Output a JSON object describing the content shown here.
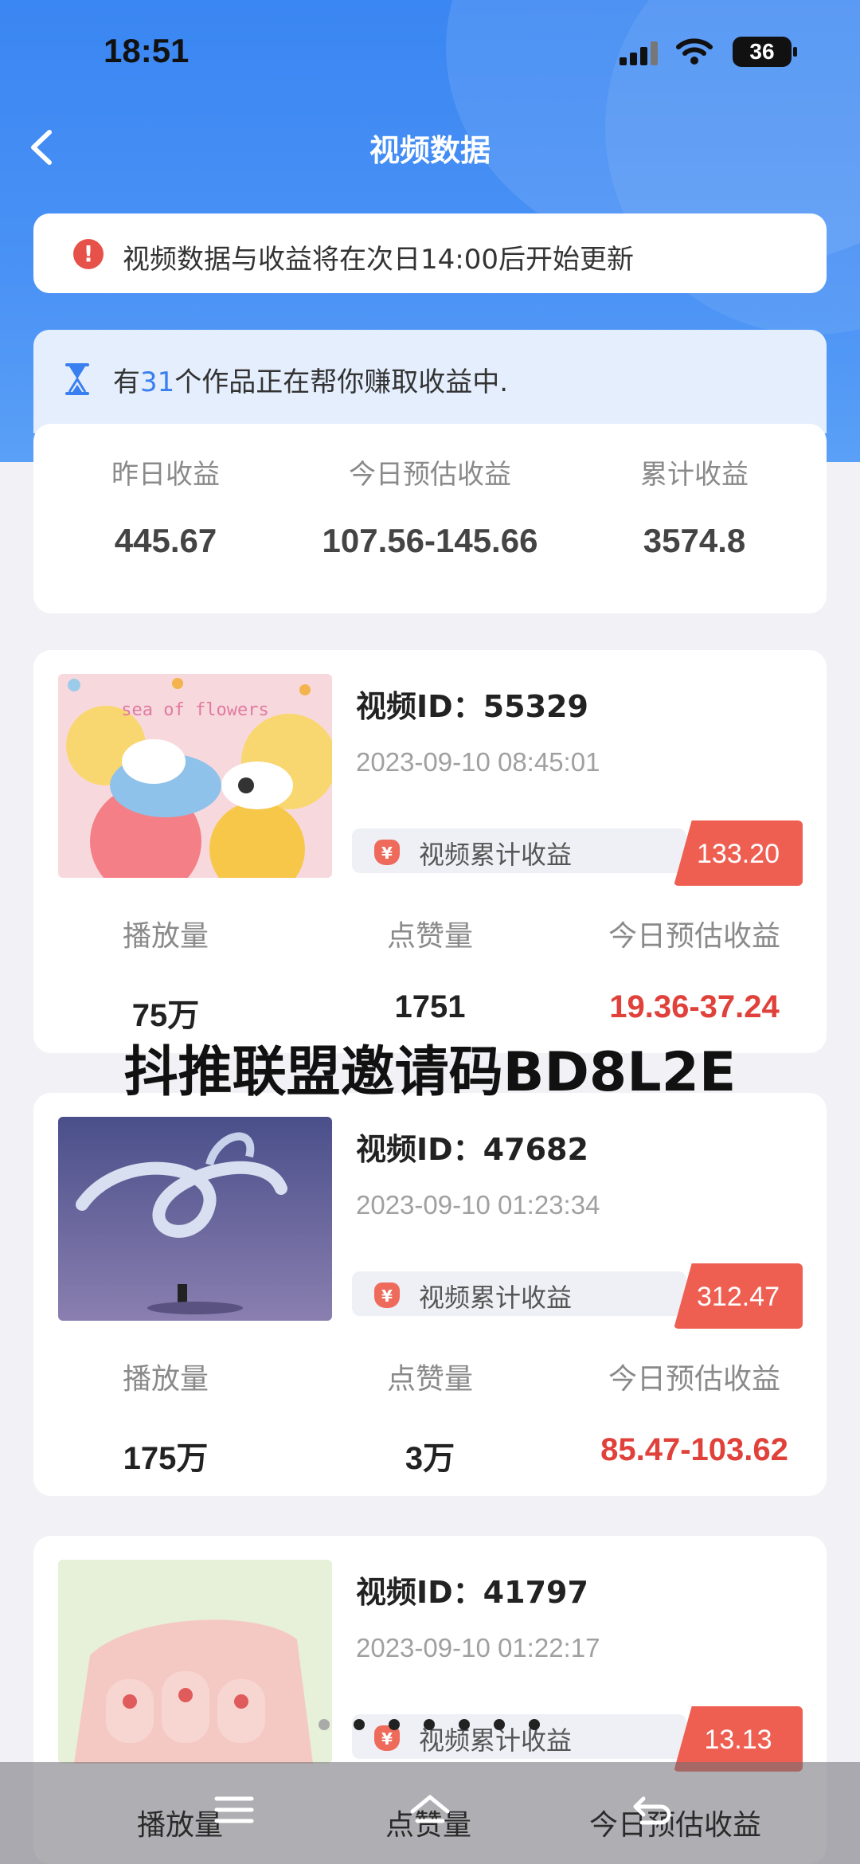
{
  "status_bar": {
    "time": "18:51",
    "battery": "36"
  },
  "nav": {
    "title": "视频数据"
  },
  "notice": {
    "text": "视频数据与收益将在次日14:00后开始更新"
  },
  "summary": {
    "earning_prefix": "有",
    "earning_count": "31",
    "earning_suffix": "个作品正在帮你赚取收益中.",
    "stats": [
      {
        "label": "昨日收益",
        "value": "445.67"
      },
      {
        "label": "今日预估收益",
        "value": "107.56-145.66"
      },
      {
        "label": "累计收益",
        "value": "3574.8"
      }
    ]
  },
  "videos": [
    {
      "id": "视频ID：55329",
      "date": "2023-09-10 08:45:01",
      "earn_label": "视频累计收益",
      "earn_amount": "133.20",
      "thumb_text": "sea of flowers",
      "plays_label": "播放量",
      "plays": "75万",
      "likes_label": "点赞量",
      "likes": "1751",
      "est_label": "今日预估收益",
      "est": "19.36-37.24"
    },
    {
      "id": "视频ID：47682",
      "date": "2023-09-10 01:23:34",
      "earn_label": "视频累计收益",
      "earn_amount": "312.47",
      "plays_label": "播放量",
      "plays": "175万",
      "likes_label": "点赞量",
      "likes": "3万",
      "est_label": "今日预估收益",
      "est": "85.47-103.62"
    },
    {
      "id": "视频ID：41797",
      "date": "2023-09-10 01:22:17",
      "earn_label": "视频累计收益",
      "earn_amount": "13.13",
      "plays_label": "播放量",
      "likes_label": "点赞量",
      "est_label": "今日预估收益"
    }
  ],
  "overlay_text": "抖推联盟邀请码BD8L2E",
  "icons": {
    "back": "chevron-left-icon",
    "notice": "alert-circle-icon",
    "summary": "hourglass-icon",
    "earn": "money-bag-icon",
    "bottom": [
      "menu-icon",
      "home-icon",
      "return-icon"
    ]
  },
  "colors": {
    "primary": "#3a86f2",
    "accent_red": "#ee5f52",
    "estimate_red": "#e0413a"
  }
}
